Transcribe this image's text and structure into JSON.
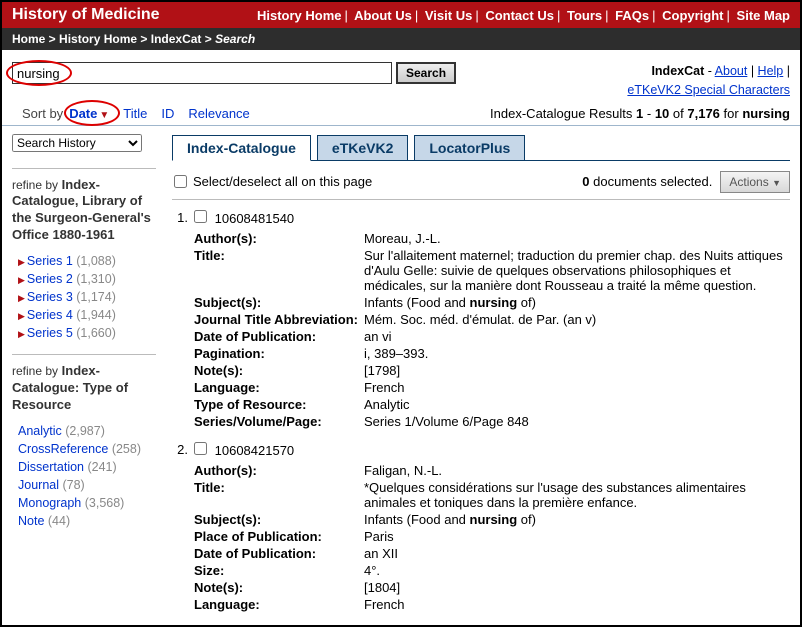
{
  "topbar": {
    "title": "History of Medicine",
    "links": [
      "History Home",
      "About Us",
      "Visit Us",
      "Contact Us",
      "Tours",
      "FAQs",
      "Copyright",
      "Site Map"
    ]
  },
  "breadcrumb": {
    "items": [
      "Home",
      "History Home",
      "IndexCat"
    ],
    "current": "Search"
  },
  "search": {
    "value": "nursing",
    "button": "Search",
    "indexcat_label": "IndexCat",
    "about": "About",
    "help": "Help",
    "special": "eTKeVK2 Special Characters"
  },
  "sort": {
    "label": "Sort by",
    "options": [
      "Date",
      "Title",
      "ID",
      "Relevance"
    ],
    "active": "Date",
    "results_text": {
      "a": "Index-Catalogue Results ",
      "b": "1",
      "c": " - ",
      "d": "10",
      "e": " of ",
      "f": "7,176",
      "g": " for ",
      "h": "nursing"
    }
  },
  "sidebar": {
    "history": "Search History",
    "refine1_label": "refine by",
    "refine1_title": "Index-Catalogue, Library of the Surgeon-General's Office 1880-1961",
    "series": [
      {
        "label": "Series 1",
        "count": "(1,088)"
      },
      {
        "label": "Series 2",
        "count": "(1,310)"
      },
      {
        "label": "Series 3",
        "count": "(1,174)"
      },
      {
        "label": "Series 4",
        "count": "(1,944)"
      },
      {
        "label": "Series 5",
        "count": "(1,660)"
      }
    ],
    "refine2_label": "refine by",
    "refine2_title": "Index-Catalogue: Type of Resource",
    "types": [
      {
        "label": "Analytic",
        "count": "(2,987)"
      },
      {
        "label": "CrossReference",
        "count": "(258)"
      },
      {
        "label": "Dissertation",
        "count": "(241)"
      },
      {
        "label": "Journal",
        "count": "(78)"
      },
      {
        "label": "Monograph",
        "count": "(3,568)"
      },
      {
        "label": "Note",
        "count": "(44)"
      }
    ]
  },
  "tabs": [
    "Index-Catalogue",
    "eTKeVK2",
    "LocatorPlus"
  ],
  "select_row": {
    "label": "Select/deselect all on this page",
    "docs_selected_num": "0",
    "docs_selected_text": " documents selected.",
    "actions": "Actions"
  },
  "records": [
    {
      "num": "1.",
      "id": "10608481540",
      "fields": [
        {
          "lab": "Author(s):",
          "val": "Moreau, J.-L."
        },
        {
          "lab": "Title:",
          "val": "Sur l'allaitement maternel; traduction du premier chap. des Nuits attiques d'Aulu Gelle: suivie de quelques observations philosophiques et médicales, sur la manière dont Rousseau a traité la même question."
        },
        {
          "lab": "Subject(s):",
          "val": "Infants (Food and nursing of)"
        },
        {
          "lab": "Journal Title Abbreviation:",
          "val": "Mém. Soc. méd. d'émulat. de Par. (an v)"
        },
        {
          "lab": "Date of Publication:",
          "val": "an vi"
        },
        {
          "lab": "Pagination:",
          "val": "i, 389–393."
        },
        {
          "lab": "Note(s):",
          "val": "[1798]"
        },
        {
          "lab": "Language:",
          "val": "French"
        },
        {
          "lab": "Type of Resource:",
          "val": "Analytic"
        },
        {
          "lab": "Series/Volume/Page:",
          "val": "Series 1/Volume 6/Page 848"
        }
      ]
    },
    {
      "num": "2.",
      "id": "10608421570",
      "fields": [
        {
          "lab": "Author(s):",
          "val": "Faligan, N.-L."
        },
        {
          "lab": "Title:",
          "val": "*Quelques considérations sur l'usage des substances alimentaires animales et toniques dans la première enfance."
        },
        {
          "lab": "Subject(s):",
          "val": "Infants (Food and nursing of)"
        },
        {
          "lab": "Place of Publication:",
          "val": "Paris"
        },
        {
          "lab": "Date of Publication:",
          "val": "an XII"
        },
        {
          "lab": "Size:",
          "val": "4°."
        },
        {
          "lab": "Note(s):",
          "val": "[1804]"
        },
        {
          "lab": "Language:",
          "val": "French"
        }
      ]
    }
  ]
}
